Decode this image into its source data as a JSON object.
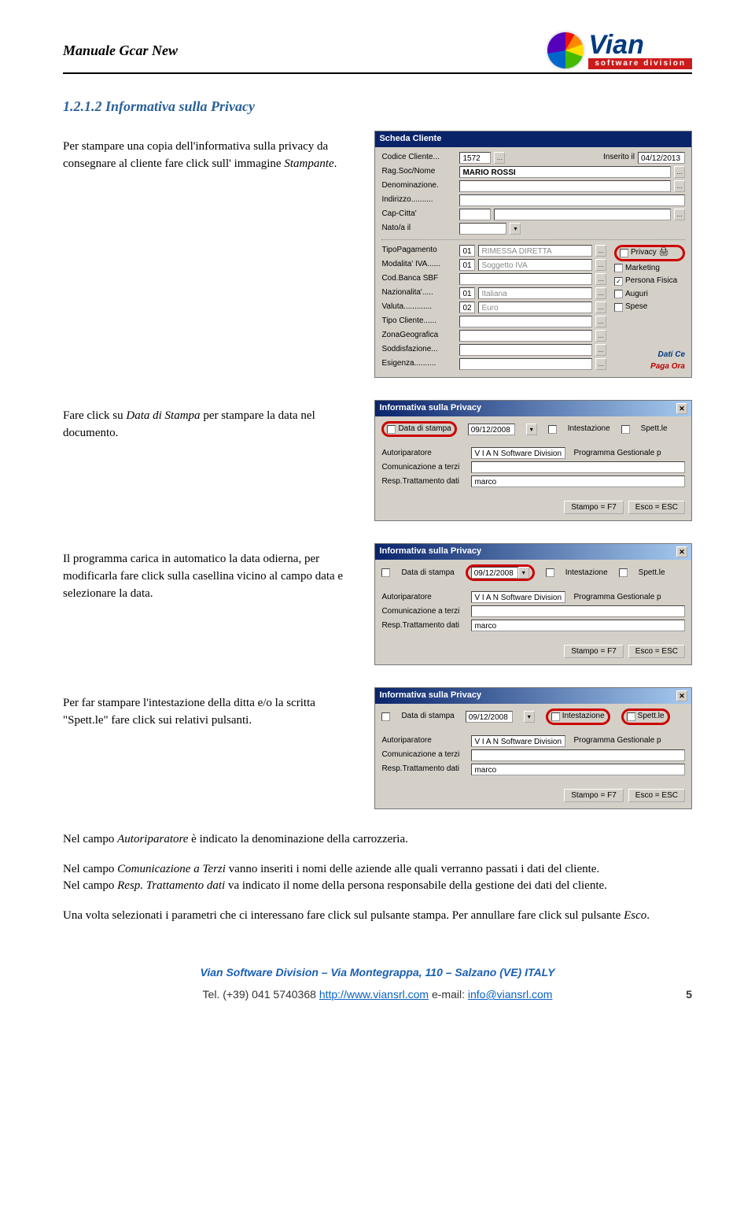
{
  "header": {
    "doc_title": "Manuale Gcar New",
    "logo_main": "Vian",
    "logo_sub": "software division"
  },
  "section_heading": "1.2.1.2 Informativa sulla Privacy",
  "paras": {
    "p1_a": "Per stampare una copia dell'informativa sulla privacy da consegnare al cliente fare click sull' immagine ",
    "p1_b": "Stampante",
    "p1_c": ".",
    "p2_a": "Fare click su ",
    "p2_b": "Data di Stampa",
    "p2_c": " per stampare la data nel documento.",
    "p3": "Il programma carica in automatico la data odierna, per modificarla fare click sulla casellina vicino al campo data e selezionare la data.",
    "p4": "Per far stampare l'intestazione della ditta e/o la scritta \"Spett.le\" fare click sui relativi pulsanti.",
    "p5_a": "Nel campo ",
    "p5_b": "Autoriparatore",
    "p5_c": " è indicato la denominazione della carrozzeria.",
    "p6_a": "Nel campo ",
    "p6_b": "Comunicazione a Terzi",
    "p6_c": " vanno inseriti i nomi delle aziende alle quali verranno passati i dati del cliente.",
    "p7_a": "Nel campo ",
    "p7_b": "Resp. Trattamento dati",
    "p7_c": " va indicato il nome della persona responsabile della gestione dei dati del cliente.",
    "p8_a": "Una volta selezionati i parametri che ci interessano fare click sul pulsante stampa. Per annullare fare click sul pulsante ",
    "p8_b": "Esco",
    "p8_c": "."
  },
  "scheda": {
    "title": "Scheda Cliente",
    "codice_label": "Codice Cliente...",
    "codice_val": "1572",
    "inserito_label": "Inserito il",
    "inserito_val": "04/12/2013",
    "rag_label": "Rag.Soc/Nome",
    "rag_val": "MARIO ROSSI",
    "denom_label": "Denominazione.",
    "indir_label": "Indirizzo..........",
    "cap_label": "Cap-Citta'",
    "nato_label": "Nato/a il",
    "tipo_pag_label": "TipoPagamento",
    "tipo_pag_code": "01",
    "tipo_pag_txt": "RIMESSA DIRETTA",
    "mod_iva_label": "Modalita' IVA......",
    "mod_iva_code": "01",
    "mod_iva_txt": "Soggetto IVA",
    "cod_banca_label": "Cod.Banca SBF",
    "naz_label": "Nazionalita'.....",
    "naz_code": "01",
    "naz_txt": "Italiana",
    "valuta_label": "Valuta.............",
    "valuta_code": "02",
    "valuta_txt": "Euro",
    "tipo_cliente_label": "Tipo Cliente......",
    "zona_label": "ZonaGeografica",
    "sodd_label": "Soddisfazione...",
    "esig_label": "Esigenza..........",
    "cb_privacy": "Privacy",
    "cb_marketing": "Marketing",
    "cb_persona": "Persona Fisica",
    "cb_auguri": "Auguri",
    "cb_spese": "Spese",
    "dati_chip": "Dati Ce",
    "paga_chip": "Paga Ora"
  },
  "privacy_dlg": {
    "title": "Informativa sulla Privacy",
    "data_stampa_label": "Data di stampa",
    "date_val": "09/12/2008",
    "intest_label": "Intestazione",
    "spett_label": "Spett.le",
    "autorip_label": "Autoriparatore",
    "autorip_val": "V I A N Software Division",
    "prog_label": "Programma Gestionale p",
    "comunic_label": "Comunicazione a terzi",
    "resp_label": "Resp.Trattamento dati",
    "resp_val": "marco",
    "btn_stampo": "Stampo = F7",
    "btn_esco": "Esco = ESC"
  },
  "footer": {
    "line1": "Vian Software Division – Via Montegrappa, 110 – Salzano (VE) ITALY",
    "tel_label": "Tel. (+39) 041 5740368 ",
    "url": "http://www.viansrl.com",
    "email_label": "   e-mail: ",
    "email": "info@viansrl.com",
    "page": "5"
  }
}
